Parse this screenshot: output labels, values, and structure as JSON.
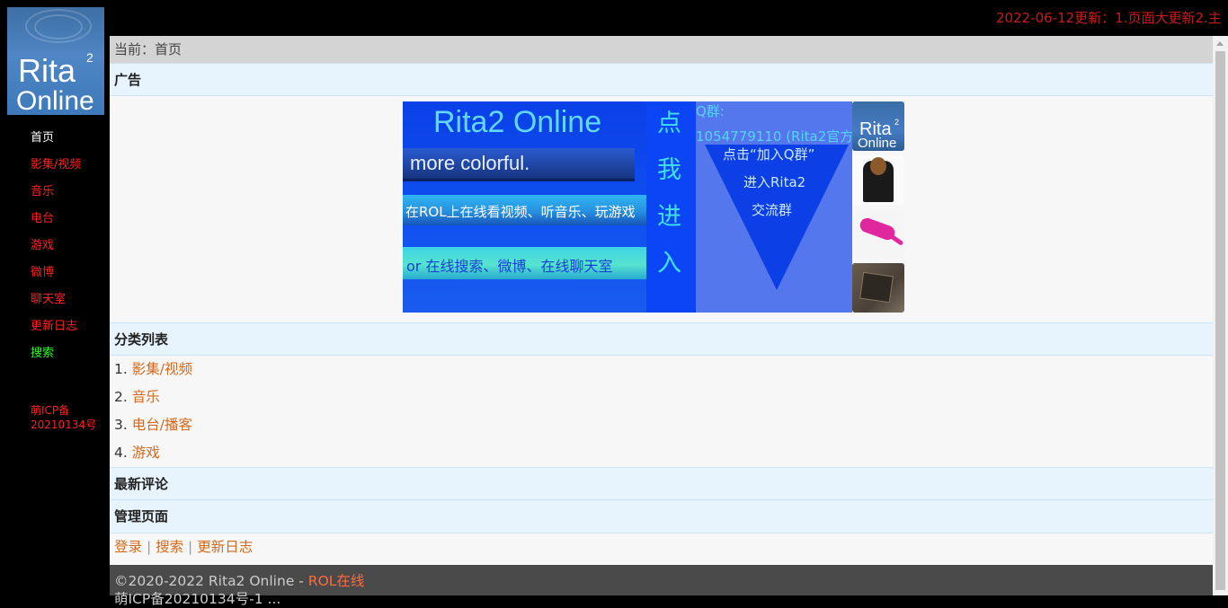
{
  "sidebar": {
    "logo": {
      "line1": "Rita",
      "sup": "2",
      "line2": "Online"
    },
    "items": [
      {
        "label": "首页",
        "color": "#ffffff"
      },
      {
        "label": "影集/视频",
        "color": "#ff2020"
      },
      {
        "label": "音乐",
        "color": "#ff2020"
      },
      {
        "label": "电台",
        "color": "#ff2020"
      },
      {
        "label": "游戏",
        "color": "#ff2020"
      },
      {
        "label": "微博",
        "color": "#ff2020"
      },
      {
        "label": "聊天室",
        "color": "#ff2020"
      },
      {
        "label": "更新日志",
        "color": "#ff2020"
      },
      {
        "label": "搜索",
        "color": "#22ff22"
      }
    ],
    "icp": "萌ICP备20210134号"
  },
  "marquee": "2022-06-12更新：1.页面大更新2.主",
  "breadcrumb": "当前：首页",
  "sections": {
    "ad": "广告",
    "categories": "分类列表",
    "comments": "最新评论",
    "admin": "管理页面"
  },
  "banner": {
    "title": "Rita2 Online",
    "slogan": "more colorful.",
    "line1": "在ROL上在线看视频、听音乐、玩游戏",
    "line2": "or 在线搜索、微博、在线聊天室",
    "vertical": [
      "点",
      "我",
      "进",
      "入"
    ],
    "qq_label": "Q群:",
    "qq_number": "1054779110 (Rita2官方)",
    "cta1": "点击“加入Q群”",
    "cta2": "进入Rita2",
    "cta3": "交流群",
    "thumb_logo": {
      "line1": "Rita",
      "sup": "2",
      "line2": "Online"
    }
  },
  "categories": [
    {
      "num": "1. ",
      "label": "影集/视频"
    },
    {
      "num": "2. ",
      "label": "音乐"
    },
    {
      "num": "3. ",
      "label": "电台/播客"
    },
    {
      "num": "4. ",
      "label": "游戏"
    }
  ],
  "admin_links": {
    "login": "登录",
    "sep": " | ",
    "search": "搜索",
    "changelog": "更新日志"
  },
  "footer": {
    "copyright": "©2020-2022 Rita2 Online - ",
    "link": "ROL在线",
    "icp": "萌ICP备20210134号-1 ..."
  },
  "colors": {
    "link": "#d2691e",
    "section_bg": "#e8f4fd",
    "nav_red": "#ff2020"
  }
}
